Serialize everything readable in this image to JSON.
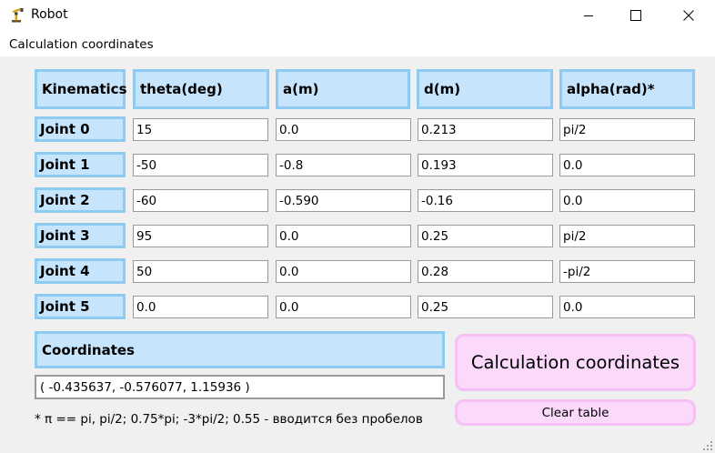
{
  "window": {
    "title": "Robot",
    "app_icon": "robot-arm-icon"
  },
  "menu": {
    "items": [
      "Calculation coordinates"
    ]
  },
  "table": {
    "headers": [
      "Kinematics",
      "theta(deg)",
      "a(m)",
      "d(m)",
      "alpha(rad)*"
    ],
    "rows": [
      {
        "label": "Joint 0",
        "values": [
          "15",
          "0.0",
          "0.213",
          "pi/2"
        ]
      },
      {
        "label": "Joint 1",
        "values": [
          "-50",
          "-0.8",
          "0.193",
          "0.0"
        ]
      },
      {
        "label": "Joint 2",
        "values": [
          "-60",
          "-0.590",
          "-0.16",
          "0.0"
        ]
      },
      {
        "label": "Joint 3",
        "values": [
          "95",
          "0.0",
          "0.25",
          "pi/2"
        ]
      },
      {
        "label": "Joint 4",
        "values": [
          "50",
          "0.0",
          "0.28",
          "-pi/2"
        ]
      },
      {
        "label": "Joint 5",
        "values": [
          "0.0",
          "0.0",
          "0.25",
          "0.0"
        ]
      }
    ]
  },
  "coordinates": {
    "label": "Coordinates",
    "value": "( -0.435637, -0.576077, 1.15936 )"
  },
  "note": "* π == pi, pi/2; 0.75*pi; -3*pi/2; 0.55 - вводится без пробелов",
  "buttons": {
    "calculate": "Calculation coordinates",
    "clear": "Clear table"
  },
  "colors": {
    "header_fill": "#c6e4fb",
    "header_border": "#8fcbf1",
    "button_fill": "#fad9fb",
    "button_border": "#f5c0f3"
  }
}
